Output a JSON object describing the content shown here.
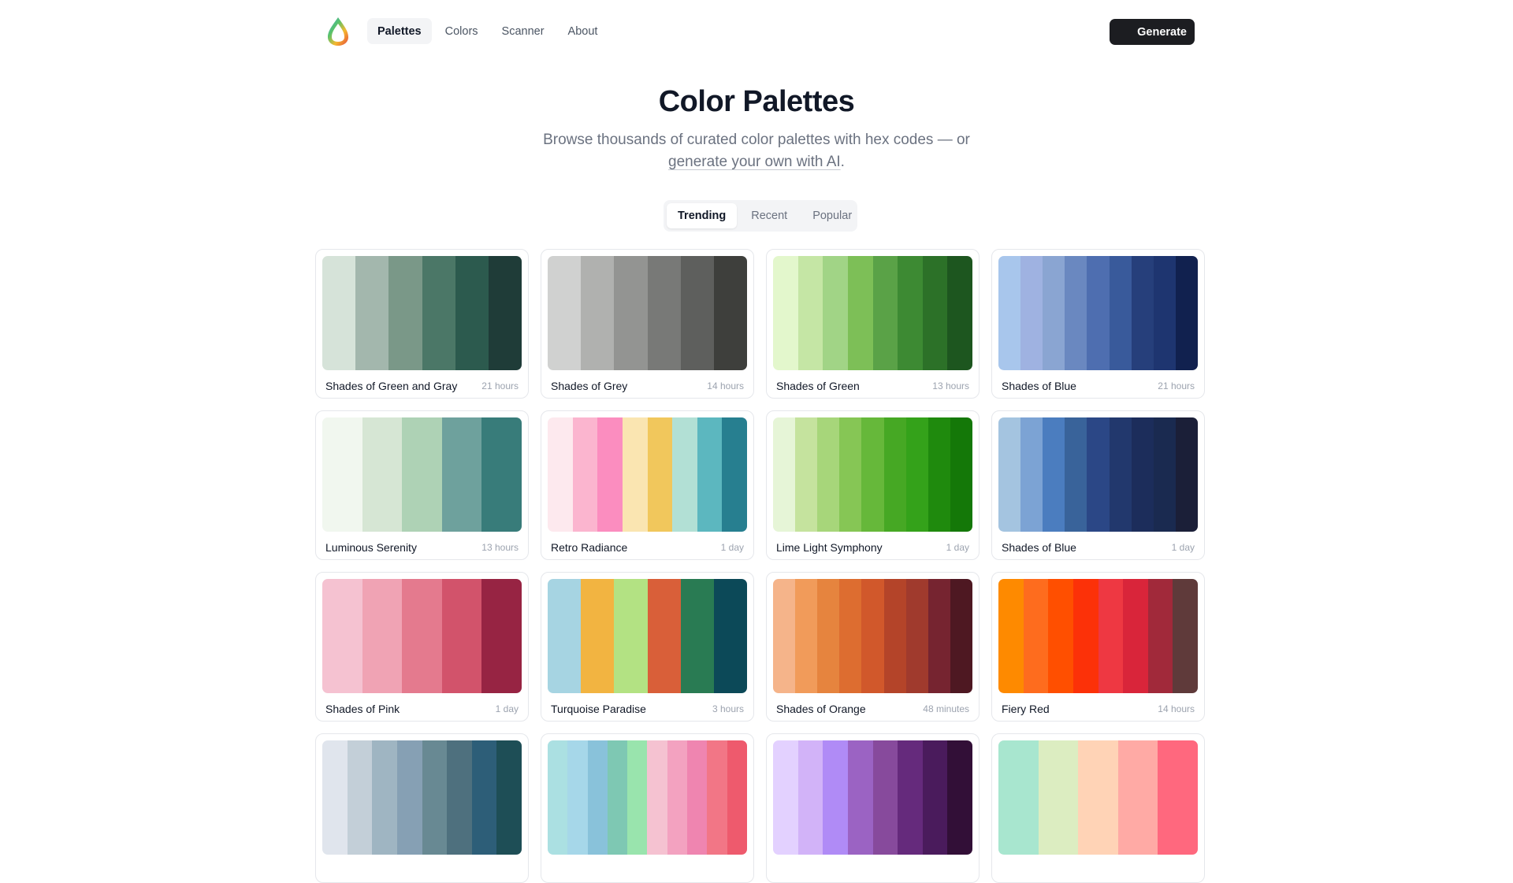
{
  "nav": {
    "items": [
      {
        "label": "Palettes",
        "active": true
      },
      {
        "label": "Colors",
        "active": false
      },
      {
        "label": "Scanner",
        "active": false
      },
      {
        "label": "About",
        "active": false
      }
    ],
    "generate_label": "Generate"
  },
  "hero": {
    "title": "Color Palettes",
    "subtitle_prefix": "Browse thousands of curated color palettes with hex codes — or",
    "subtitle_link": "generate your own with AI",
    "subtitle_suffix": "."
  },
  "tabs": [
    {
      "label": "Trending",
      "active": true
    },
    {
      "label": "Recent",
      "active": false
    },
    {
      "label": "Popular",
      "active": false
    }
  ],
  "palettes": [
    {
      "name": "Shades of Green and Gray",
      "time": "21 hours",
      "colors": [
        "#d6e3d9",
        "#a3b7ad",
        "#7a9888",
        "#4b7767",
        "#2c5a4e",
        "#1f3c38"
      ]
    },
    {
      "name": "Shades of Grey",
      "time": "14 hours",
      "colors": [
        "#d0d1d0",
        "#b0b1af",
        "#939492",
        "#787977",
        "#5e5f5d",
        "#3e3f3c"
      ]
    },
    {
      "name": "Shades of Green",
      "time": "13 hours",
      "colors": [
        "#e3f7cc",
        "#c5e6a5",
        "#a1d486",
        "#7dbf57",
        "#5aa247",
        "#3d8a33",
        "#2c7128",
        "#1d561f"
      ]
    },
    {
      "name": "Shades of Blue",
      "time": "21 hours",
      "colors": [
        "#a8c6ec",
        "#9fb2e1",
        "#8aa5d2",
        "#6a88c0",
        "#4e6eb0",
        "#395a9b",
        "#263f7b",
        "#1e3570",
        "#11214f"
      ]
    },
    {
      "name": "Luminous Serenity",
      "time": "13 hours",
      "colors": [
        "#f1f7ef",
        "#d6e6d4",
        "#aed2b5",
        "#6ea19d",
        "#387c7a"
      ]
    },
    {
      "name": "Retro Radiance",
      "time": "1 day",
      "colors": [
        "#fde9ee",
        "#fbb5cf",
        "#fb8dbf",
        "#fae5b1",
        "#f1c75c",
        "#b2e0d5",
        "#5cb7bf",
        "#277f90"
      ]
    },
    {
      "name": "Lime Light Symphony",
      "time": "1 day",
      "colors": [
        "#e6f5d7",
        "#c5e39e",
        "#a7d67a",
        "#86c655",
        "#66b83a",
        "#46a824",
        "#34a21a",
        "#1f8a0d",
        "#147808"
      ]
    },
    {
      "name": "Shades of Blue",
      "time": "1 day",
      "colors": [
        "#a4c4e0",
        "#7ca3d4",
        "#4b7dbf",
        "#39639a",
        "#2b4786",
        "#22386d",
        "#1c2d5b",
        "#1a2a50",
        "#1b1f38"
      ]
    },
    {
      "name": "Shades of Pink",
      "time": "1 day",
      "colors": [
        "#f5c2d1",
        "#f0a3b4",
        "#e47a8e",
        "#d2536b",
        "#972443"
      ]
    },
    {
      "name": "Turquoise Paradise",
      "time": "3 hours",
      "colors": [
        "#a6d4e2",
        "#f2b441",
        "#b3e283",
        "#d95f39",
        "#297b53",
        "#0c4958"
      ]
    },
    {
      "name": "Shades of Orange",
      "time": "48 minutes",
      "colors": [
        "#f5b48a",
        "#f19b5a",
        "#e6843e",
        "#dd6d30",
        "#d1582b",
        "#b44429",
        "#a03a2d",
        "#762430",
        "#4e1822"
      ]
    },
    {
      "name": "Fiery Red",
      "time": "14 hours",
      "colors": [
        "#fe8a00",
        "#fe6c1e",
        "#ff4f00",
        "#fc3108",
        "#ee3842",
        "#d9253a",
        "#a1293a",
        "#5f3a3a"
      ]
    },
    {
      "name": "",
      "time": "",
      "colors": [
        "#e0e5ed",
        "#c3cfd8",
        "#9fb5c2",
        "#86a0b4",
        "#688993",
        "#4e707e",
        "#2d5e78",
        "#1e4e56"
      ]
    },
    {
      "name": "",
      "time": "",
      "colors": [
        "#abe0e2",
        "#a6d7e9",
        "#89c2da",
        "#7ec8b3",
        "#99e4ad",
        "#f5c2d1",
        "#f3a2c0",
        "#ef85b0",
        "#f27686",
        "#ee5a6d"
      ]
    },
    {
      "name": "",
      "time": "",
      "colors": [
        "#e3d1ff",
        "#d2b3f8",
        "#b08bf6",
        "#9b63c3",
        "#874a9c",
        "#652a7c",
        "#4a1b5c",
        "#320f37"
      ]
    },
    {
      "name": "",
      "time": "",
      "colors": [
        "#a8e6cf",
        "#dcedc1",
        "#ffd3b6",
        "#ffaaa5",
        "#ff687e"
      ]
    }
  ]
}
